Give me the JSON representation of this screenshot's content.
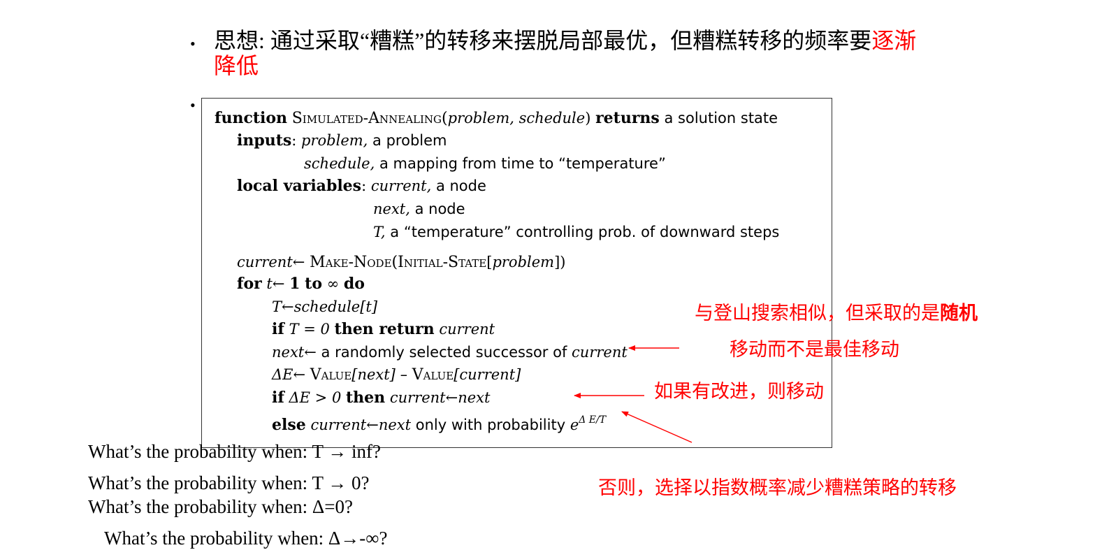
{
  "heading": {
    "black": "思想: 通过采取“糟糕”的转移来摆脱局部最优，但糟糕转移的频率要",
    "red_first": "逐渐",
    "red_second": "降低"
  },
  "algorithm": {
    "l1_kw1": "function",
    "l1_name": "Simulated-Annealing(",
    "l1_args": "problem, schedule",
    "l1_close": ")",
    "l1_kw2": "returns",
    "l1_rest": "a solution state",
    "l2_kw": "inputs",
    "l2_colon": ":",
    "l2_var": "problem,",
    "l2_rest": "a problem",
    "l3_var": "schedule,",
    "l3_rest": "a mapping from time to “temperature”",
    "l4_kw": "local variables",
    "l4_colon": ":",
    "l4_var": "current,",
    "l4_rest": "a node",
    "l5_var": "next,",
    "l5_rest": "a node",
    "l6_var": "T,",
    "l6_rest": "a “temperature” controlling prob. of downward steps",
    "l7_var": "current",
    "l7_arrow": "←",
    "l7_f1": "Make-Node(",
    "l7_f2": "Initial-State",
    "l7_bracket": "[",
    "l7_arg": "problem",
    "l7_close": "])",
    "l8_kw1": "for",
    "l8_var": "t",
    "l8_arrow": "←",
    "l8_one": "1",
    "l8_kw2": "to",
    "l8_inf": "∞",
    "l8_kw3": "do",
    "l9_var": "T",
    "l9_arrow": "←",
    "l9_fn": "schedule[t]",
    "l10_kw1": "if",
    "l10_cond": "T = 0",
    "l10_kw2": "then return",
    "l10_var": "current",
    "l11_var": "next",
    "l11_arrow": "←",
    "l11_rest": "a randomly selected successor of",
    "l11_var2": "current",
    "l12_delta": "ΔE",
    "l12_arrow": "←",
    "l12_v1": "Value",
    "l12_a1": "[next]",
    "l12_minus": "–",
    "l12_v2": "Value",
    "l12_a2": "[current]",
    "l13_kw1": "if",
    "l13_cond": "ΔE > 0",
    "l13_kw2": "then",
    "l13_var": "current",
    "l13_arrow": "←",
    "l13_var2": "next",
    "l14_kw": "else",
    "l14_var": "current",
    "l14_arrow": "←",
    "l14_var2": "next",
    "l14_rest": "only with probability",
    "l14_e": "e",
    "l14_exp": "Δ E/T"
  },
  "annotations": {
    "a1_line1_normal": "与登山搜索相似，但采取的是",
    "a1_line1_bold": "随机",
    "a1_line2": "移动而不是最佳移动",
    "a2": "如果有改进，则移动",
    "a3": "否则，选择以指数概率减少糟糕策略的转移"
  },
  "questions": [
    "What’s the probability when: T → inf?",
    "What’s the probability when: T → 0?",
    "What’s the probability when:  Δ=0?",
    "What’s the probability when:  Δ→-∞?"
  ],
  "bullets": [
    "•",
    "•"
  ],
  "colors": {
    "accent": "#ff0000",
    "text": "#000000",
    "border": "#333333"
  }
}
